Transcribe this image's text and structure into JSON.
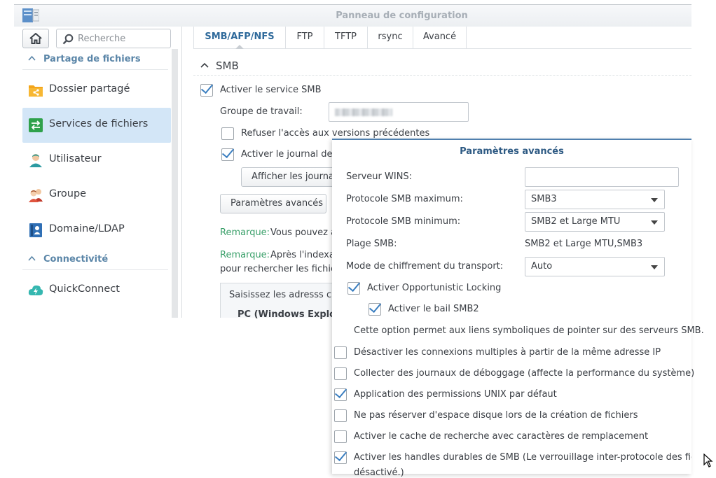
{
  "window": {
    "title": "Panneau de configuration"
  },
  "sidebar": {
    "search_placeholder": "Recherche",
    "sections": [
      {
        "label": "Partage de fichiers"
      },
      {
        "label": "Connectivité"
      }
    ],
    "items": [
      {
        "label": "Dossier partagé",
        "icon": "shared-folder-icon"
      },
      {
        "label": "Services de fichiers",
        "icon": "file-services-icon",
        "active": true
      },
      {
        "label": "Utilisateur",
        "icon": "user-icon"
      },
      {
        "label": "Groupe",
        "icon": "group-icon"
      },
      {
        "label": "Domaine/LDAP",
        "icon": "domain-ldap-icon"
      },
      {
        "label": "QuickConnect",
        "icon": "quickconnect-icon"
      }
    ]
  },
  "tabs": [
    "SMB/AFP/NFS",
    "FTP",
    "TFTP",
    "rsync",
    "Avancé"
  ],
  "smb": {
    "title": "SMB",
    "enable_label": "Activer le service SMB",
    "enable_checked": true,
    "workgroup_label": "Groupe de travail:",
    "deny_prev_label": "Refuser l'accès aux versions précédentes",
    "deny_prev_checked": false,
    "log_label": "Activer le journal des",
    "log_checked": true,
    "show_log_button": "Afficher les journau",
    "advanced_button": "Paramètres avancés",
    "remark1_prefix": "Remarque:",
    "remark1_text": "Vous pouvez a",
    "remark2_prefix": "Remarque:",
    "remark2_text": "Après l'indexat",
    "remark2_line2": "pour rechercher les fichiers",
    "hint_line1": "Saisissez les adresss ci-",
    "hint_line2": "PC (Windows Explor"
  },
  "advanced": {
    "title": "Paramètres avancés",
    "wins_label": "Serveur WINS:",
    "wins_value": "",
    "max_proto_label": "Protocole SMB maximum:",
    "max_proto_value": "SMB3",
    "min_proto_label": "Protocole SMB minimum:",
    "min_proto_value": "SMB2 et Large MTU",
    "range_label": "Plage SMB:",
    "range_value": "SMB2 et Large MTU,SMB3",
    "encrypt_label": "Mode de chiffrement du transport:",
    "encrypt_value": "Auto",
    "oplock_label": "Activer Opportunistic Locking",
    "oplock_checked": true,
    "lease_label": "Activer le bail SMB2",
    "lease_checked": true,
    "symlink_note": "Cette option permet aux liens symboliques de pointer sur des serveurs SMB.",
    "options": [
      {
        "label": "Désactiver les connexions multiples à partir de la même adresse IP",
        "checked": false
      },
      {
        "label": "Collecter des journaux de déboggage (affecte la performance du système)",
        "checked": false
      },
      {
        "label": "Application des permissions UNIX par défaut",
        "checked": true
      },
      {
        "label": "Ne pas réserver d'espace disque lors de la création de fichiers",
        "checked": false
      },
      {
        "label": "Activer le cache de recherche avec caractères de remplacement",
        "checked": false
      },
      {
        "label": "Activer les handles durables de SMB (Le verrouillage inter-protocole des fichiers sera",
        "checked": true
      }
    ],
    "durable_line2": "désactivé.)"
  }
}
